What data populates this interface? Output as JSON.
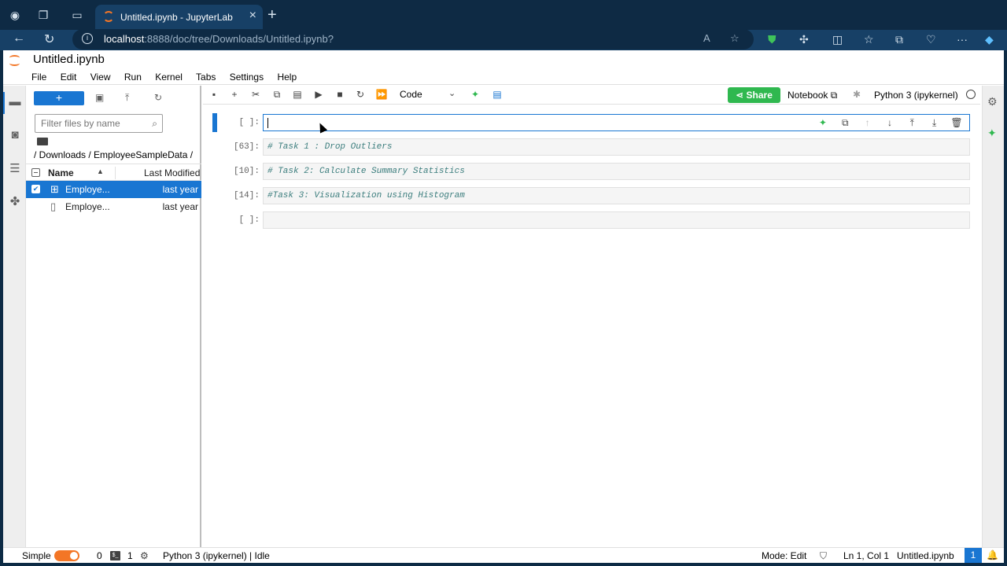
{
  "browser": {
    "tab_title": "Untitled.ipynb - JupyterLab",
    "url_host": "localhost",
    "url_rest": ":8888/doc/tree/Downloads/Untitled.ipynb?"
  },
  "app": {
    "document_title": "Untitled.ipynb",
    "menu": [
      "File",
      "Edit",
      "View",
      "Run",
      "Kernel",
      "Tabs",
      "Settings",
      "Help"
    ]
  },
  "filebrowser": {
    "new_label": "+",
    "filter_placeholder": "Filter files by name",
    "breadcrumb": "/ Downloads / EmployeeSampleData /",
    "col_name": "Name",
    "col_modified": "Last Modified",
    "files": [
      {
        "name": "Employe...",
        "modified": "last year",
        "selected": true,
        "kind": "spreadsheet"
      },
      {
        "name": "Employe...",
        "modified": "last year",
        "selected": false,
        "kind": "file"
      }
    ]
  },
  "notebook": {
    "cell_type": "Code",
    "share_label": "Share",
    "notebook_label": "Notebook",
    "kernel_name": "Python 3 (ipykernel)",
    "cells": [
      {
        "prompt": "[ ]:",
        "source": "",
        "active": true
      },
      {
        "prompt": "[63]:",
        "source": "# Task 1 : Drop Outliers",
        "active": false
      },
      {
        "prompt": "[10]:",
        "source": "# Task 2: Calculate Summary Statistics",
        "active": false
      },
      {
        "prompt": "[14]:",
        "source": "#Task 3: Visualization using Histogram",
        "active": false
      },
      {
        "prompt": "[ ]:",
        "source": "",
        "active": false
      }
    ]
  },
  "statusbar": {
    "mode_toggle_label": "Simple",
    "terminals_count": "0",
    "kernels_count": "1",
    "kernel_status": "Python 3 (ipykernel) | Idle",
    "mode": "Mode: Edit",
    "cursor_pos": "Ln 1, Col 1",
    "filename": "Untitled.ipynb",
    "notifications": "1"
  },
  "colors": {
    "brand_blue": "#1976d2",
    "jupyter_orange": "#f37626",
    "share_green": "#2fb84f",
    "browser_chrome": "#0e2a44"
  }
}
